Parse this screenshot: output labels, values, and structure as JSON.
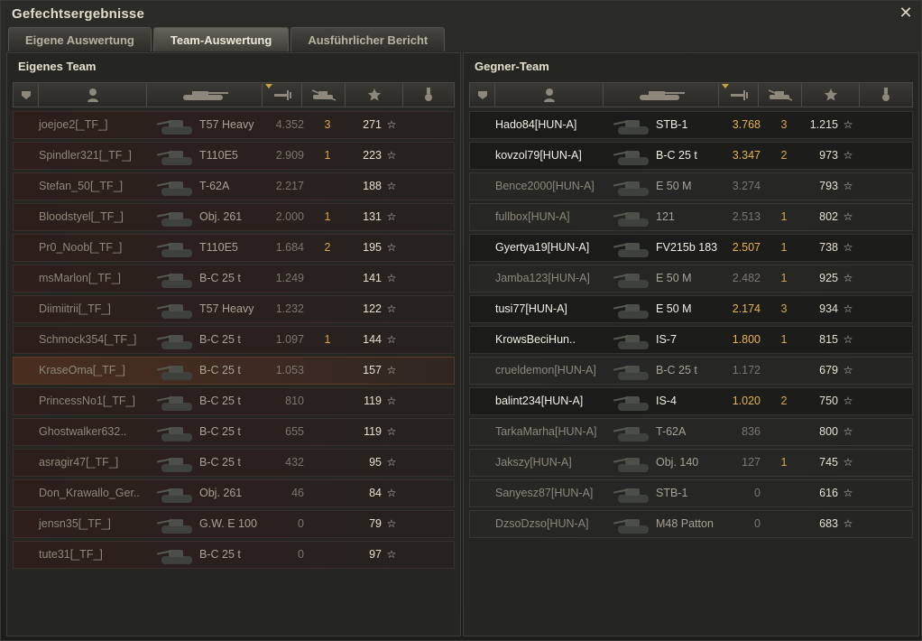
{
  "window": {
    "title": "Gefechtsergebnisse"
  },
  "tabs": [
    {
      "label": "Eigene Auswertung",
      "active": false
    },
    {
      "label": "Team-Auswertung",
      "active": true
    },
    {
      "label": "Ausführlicher Bericht",
      "active": false
    }
  ],
  "columns": [
    "squad-icon",
    "player-icon",
    "tank-icon",
    "damage-icon",
    "kills-icon",
    "xp-star-icon",
    "medal-icon"
  ],
  "own_team": {
    "title": "Eigenes Team",
    "rows": [
      {
        "player": "joejoe2[_TF_]",
        "tank": "T57 Heavy",
        "damage": "4.352",
        "kills": "3",
        "xp": "271"
      },
      {
        "player": "Spindler321[_TF_]",
        "tank": "T110E5",
        "damage": "2.909",
        "kills": "1",
        "xp": "223"
      },
      {
        "player": "Stefan_50[_TF_]",
        "tank": "T-62A",
        "damage": "2.217",
        "kills": "",
        "xp": "188"
      },
      {
        "player": "Bloodstyel[_TF_]",
        "tank": "Obj. 261",
        "damage": "2.000",
        "kills": "1",
        "xp": "131"
      },
      {
        "player": "Pr0_Noob[_TF_]",
        "tank": "T110E5",
        "damage": "1.684",
        "kills": "2",
        "xp": "195"
      },
      {
        "player": "msMarlon[_TF_]",
        "tank": "B-C 25 t",
        "damage": "1.249",
        "kills": "",
        "xp": "141"
      },
      {
        "player": "Diimiitrii[_TF_]",
        "tank": "T57 Heavy",
        "damage": "1.232",
        "kills": "",
        "xp": "122"
      },
      {
        "player": "Schmock354[_TF_]",
        "tank": "B-C 25 t",
        "damage": "1.097",
        "kills": "1",
        "xp": "144"
      },
      {
        "player": "KraseOma[_TF_]",
        "tank": "B-C 25 t",
        "damage": "1.053",
        "kills": "",
        "xp": "157",
        "highlight": true
      },
      {
        "player": "PrincessNo1[_TF_]",
        "tank": "B-C 25 t",
        "damage": "810",
        "kills": "",
        "xp": "119"
      },
      {
        "player": "Ghostwalker632..",
        "tank": "B-C 25 t",
        "damage": "655",
        "kills": "",
        "xp": "119"
      },
      {
        "player": "asragir47[_TF_]",
        "tank": "B-C 25 t",
        "damage": "432",
        "kills": "",
        "xp": "95"
      },
      {
        "player": "Don_Krawallo_Ger..",
        "tank": "Obj. 261",
        "damage": "46",
        "kills": "",
        "xp": "84"
      },
      {
        "player": "jensn35[_TF_]",
        "tank": "G.W. E 100",
        "damage": "0",
        "kills": "",
        "xp": "79"
      },
      {
        "player": "tute31[_TF_]",
        "tank": "B-C 25 t",
        "damage": "0",
        "kills": "",
        "xp": "97"
      }
    ]
  },
  "enemy_team": {
    "title": "Gegner-Team",
    "rows": [
      {
        "player": "Hado84[HUN-A]",
        "tank": "STB-1",
        "damage": "3.768",
        "kills": "3",
        "xp": "1.215",
        "alive": true
      },
      {
        "player": "kovzol79[HUN-A]",
        "tank": "B-C 25 t",
        "damage": "3.347",
        "kills": "2",
        "xp": "973",
        "alive": true
      },
      {
        "player": "Bence2000[HUN-A]",
        "tank": "E 50 M",
        "damage": "3.274",
        "kills": "",
        "xp": "793"
      },
      {
        "player": "fullbox[HUN-A]",
        "tank": "121",
        "damage": "2.513",
        "kills": "1",
        "xp": "802"
      },
      {
        "player": "Gyertya19[HUN-A]",
        "tank": "FV215b 183",
        "damage": "2.507",
        "kills": "1",
        "xp": "738",
        "alive": true
      },
      {
        "player": "Jamba123[HUN-A]",
        "tank": "E 50 M",
        "damage": "2.482",
        "kills": "1",
        "xp": "925"
      },
      {
        "player": "tusi77[HUN-A]",
        "tank": "E 50 M",
        "damage": "2.174",
        "kills": "3",
        "xp": "934",
        "alive": true
      },
      {
        "player": "KrowsBeciHun..",
        "tank": "IS-7",
        "damage": "1.800",
        "kills": "1",
        "xp": "815",
        "alive": true
      },
      {
        "player": "crueldemon[HUN-A]",
        "tank": "B-C 25 t",
        "damage": "1.172",
        "kills": "",
        "xp": "679"
      },
      {
        "player": "balint234[HUN-A]",
        "tank": "IS-4",
        "damage": "1.020",
        "kills": "2",
        "xp": "750",
        "alive": true
      },
      {
        "player": "TarkaMarha[HUN-A]",
        "tank": "T-62A",
        "damage": "836",
        "kills": "",
        "xp": "800"
      },
      {
        "player": "Jakszy[HUN-A]",
        "tank": "Obj. 140",
        "damage": "127",
        "kills": "1",
        "xp": "745"
      },
      {
        "player": "Sanyesz87[HUN-A]",
        "tank": "STB-1",
        "damage": "0",
        "kills": "",
        "xp": "616"
      },
      {
        "player": "DzsoDzso[HUN-A]",
        "tank": "M48 Patton",
        "damage": "0",
        "kills": "",
        "xp": "683"
      }
    ]
  },
  "colors": {
    "accent": "#e6b450",
    "kills": "#d6a84c",
    "row_own": "#2d1e1b",
    "row_enemy": "#272724"
  }
}
